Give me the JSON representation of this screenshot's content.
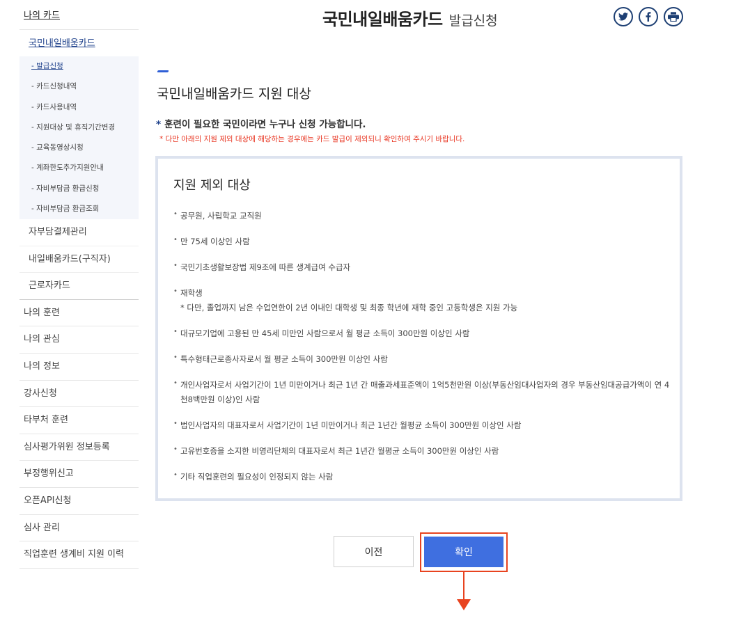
{
  "sidebar": {
    "top": "나의 카드",
    "sub_title": "국민내일배움카드",
    "sub_items": [
      {
        "label": "- 발급신청"
      },
      {
        "label": "- 카드신청내역"
      },
      {
        "label": "- 카드사용내역"
      },
      {
        "label": "- 지원대상 및 휴직기간변경"
      },
      {
        "label": "- 교육동영상시청"
      },
      {
        "label": "- 계좌한도추가지원안내"
      },
      {
        "label": "- 자비부담금 환급신청"
      },
      {
        "label": "- 자비부담금 환급조회"
      }
    ],
    "groups": [
      {
        "label": "자부담결제관리"
      },
      {
        "label": "내일배움카드(구직자)"
      },
      {
        "label": "근로자카드"
      }
    ],
    "main_items": [
      {
        "label": "나의 훈련"
      },
      {
        "label": "나의 관심"
      },
      {
        "label": "나의 정보"
      },
      {
        "label": "강사신청"
      },
      {
        "label": "타부처 훈련"
      },
      {
        "label": "심사평가위원 정보등록"
      },
      {
        "label": "부정행위신고"
      },
      {
        "label": "오픈API신청"
      },
      {
        "label": "심사 관리"
      },
      {
        "label": "직업훈련 생계비 지원 이력"
      }
    ]
  },
  "header": {
    "title_main": "국민내일배움카드",
    "title_sub": "발급신청"
  },
  "share": {
    "twitter": "twitter-icon",
    "facebook": "facebook-icon",
    "print": "print-icon"
  },
  "section": {
    "title": "국민내일배움카드 지원 대상",
    "notice_star": "*",
    "notice_main": "훈련이 필요한 국민이라면 누구나 신청 가능합니다.",
    "notice_red": "* 다만 아래의 지원 제외 대상에 해당하는 경우에는 카드 발급이 제외되니 확인하여 주시기 바랍니다."
  },
  "exclusion": {
    "title": "지원 제외 대상",
    "items": [
      {
        "text": "공무원, 사립학교 교직원",
        "sub": ""
      },
      {
        "text": "만 75세 이상인 사람",
        "sub": ""
      },
      {
        "text": "국민기초생활보장법 제9조에 따른 생계급여 수급자",
        "sub": ""
      },
      {
        "text": "재학생",
        "sub": "* 다만, 졸업까지 남은 수업연한이 2년 이내인 대학생 및 최종 학년에 재학 중인 고등학생은 지원 가능"
      },
      {
        "text": "대규모기업에 고용된 만 45세 미만인 사람으로서 월 평균 소득이 300만원 이상인 사람",
        "sub": ""
      },
      {
        "text": "특수형태근로종사자로서 월 평균 소득이 300만원 이상인 사람",
        "sub": ""
      },
      {
        "text": "개인사업자로서 사업기간이 1년 미만이거나 최근 1년 간 매출과세표준액이 1억5천만원 이상(부동산임대사업자의 경우 부동산임대공급가액이 연 4천8백만원 이상)인 사람",
        "sub": ""
      },
      {
        "text": "법인사업자의 대표자로서 사업기간이 1년 미만이거나 최근 1년간 월평균 소득이 300만원 이상인 사람",
        "sub": ""
      },
      {
        "text": "고유번호증을 소지한 비영리단체의 대표자로서 최근 1년간 월평균 소득이 300만원 이상인 사람",
        "sub": ""
      },
      {
        "text": "기타 직업훈련의 필요성이 인정되지 않는 사람",
        "sub": ""
      }
    ]
  },
  "buttons": {
    "prev": "이전",
    "confirm": "확인"
  },
  "colors": {
    "accent": "#3f6fe0",
    "highlight": "#e8431f",
    "notice_red": "#e8331f",
    "navy": "#1c3f8a"
  }
}
